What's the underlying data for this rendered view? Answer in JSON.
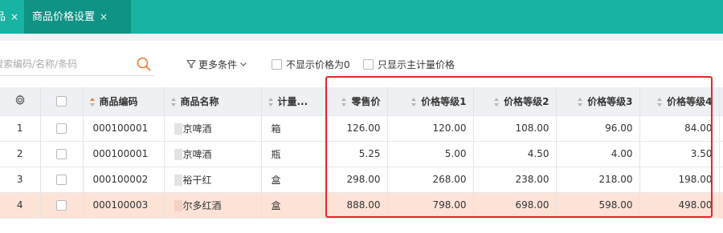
{
  "tabs": [
    {
      "label": "品",
      "close": "×",
      "active": false
    },
    {
      "label": "商品价格设置",
      "close": "×",
      "active": true
    }
  ],
  "toolbar": {
    "search_placeholder": "搜索编码/名称/条码",
    "more_label": "更多条件",
    "checkbox_hide_zero": "不显示价格为0",
    "checkbox_main_unit": "只显示主计量价格"
  },
  "table": {
    "headers": {
      "code": "商品编码",
      "name": "商品名称",
      "unit": "计量...",
      "retail": "零售价",
      "level1": "价格等级1",
      "level2": "价格等级2",
      "level3": "价格等级3",
      "level4": "价格等级4"
    },
    "rows": [
      {
        "index": "1",
        "code": "000100001",
        "name": "京啤酒",
        "unit": "箱",
        "retail": "126.00",
        "level1": "120.00",
        "level2": "108.00",
        "level3": "96.00",
        "level4": "84.00",
        "selected": false
      },
      {
        "index": "2",
        "code": "000100001",
        "name": "京啤酒",
        "unit": "瓶",
        "retail": "5.25",
        "level1": "5.00",
        "level2": "4.50",
        "level3": "4.00",
        "level4": "3.50",
        "selected": false
      },
      {
        "index": "3",
        "code": "000100002",
        "name": "裕干红",
        "unit": "盒",
        "retail": "298.00",
        "level1": "268.00",
        "level2": "238.00",
        "level3": "218.00",
        "level4": "198.00",
        "selected": false
      },
      {
        "index": "4",
        "code": "000100003",
        "name": "尔多红酒",
        "unit": "盒",
        "retail": "888.00",
        "level1": "798.00",
        "level2": "698.00",
        "level3": "598.00",
        "level4": "498.00",
        "selected": true
      }
    ]
  },
  "colors": {
    "tabbar": "#17b3a3",
    "active_tab": "#0e9384",
    "selected_row": "#fde3d6",
    "highlight_border": "#e5262a",
    "sort_active": "#f37b33",
    "search_icon": "#f37b33"
  },
  "icons": {
    "search": "search-icon",
    "filter": "filter-icon",
    "settings": "gear-icon"
  }
}
